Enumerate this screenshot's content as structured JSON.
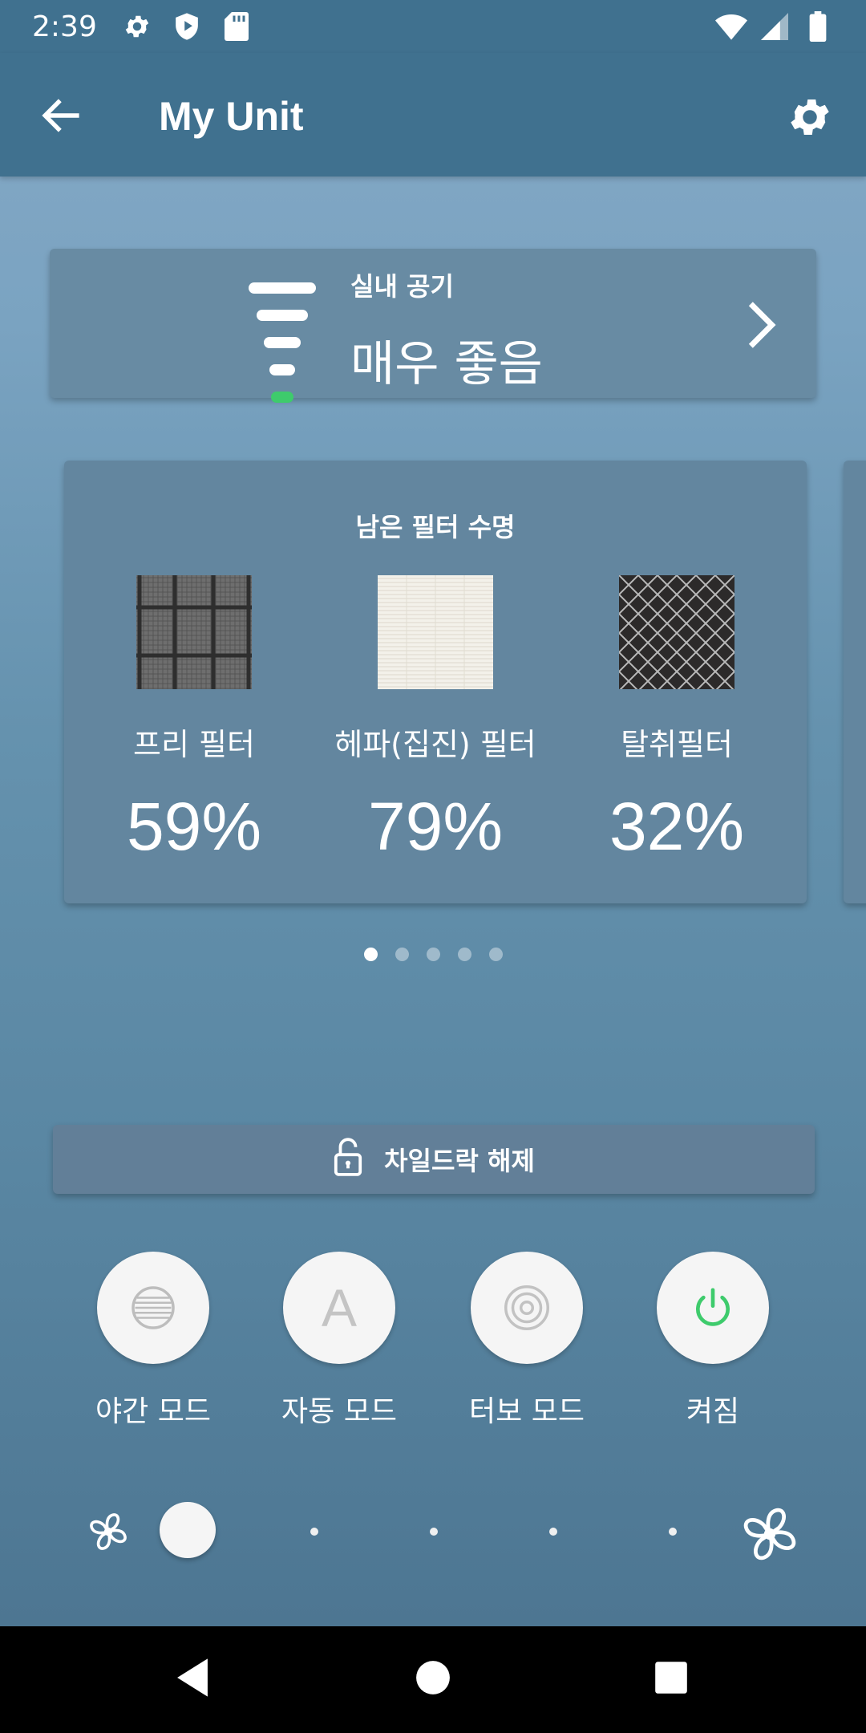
{
  "status_bar": {
    "time": "2:39",
    "icons": [
      "gear-icon",
      "shield-play-icon",
      "sd-card-icon",
      "wifi-icon",
      "signal-icon",
      "battery-icon"
    ]
  },
  "app_bar": {
    "title": "My Unit",
    "back_icon": "arrow-left-icon",
    "settings_icon": "gear-icon"
  },
  "air_quality": {
    "label": "실내 공기",
    "value": "매우 좋음",
    "level_color": "#3ecb6c",
    "icon": "air-quality-bars-icon"
  },
  "filter_life": {
    "title": "남은 필터 수명",
    "filters": [
      {
        "name": "프리 필터",
        "percent": "59%"
      },
      {
        "name": "헤파(집진) 필터",
        "percent": "79%"
      },
      {
        "name": "탈취필터",
        "percent": "32%"
      }
    ]
  },
  "pager": {
    "count": 5,
    "active": 0
  },
  "child_lock": {
    "label": "차일드락 해제",
    "icon": "unlock-icon"
  },
  "modes": [
    {
      "label": "야간 모드",
      "icon": "night-mode-icon"
    },
    {
      "label": "자동 모드",
      "icon": "auto-mode-icon",
      "glyph": "A"
    },
    {
      "label": "터보 모드",
      "icon": "turbo-mode-icon"
    },
    {
      "label": "켜짐",
      "icon": "power-icon",
      "accent": "#3ecb6c"
    }
  ],
  "fan_speed": {
    "current_step": 1,
    "steps": 5
  },
  "colors": {
    "app_bar": "#40718f",
    "accent_green": "#3ecb6c"
  }
}
